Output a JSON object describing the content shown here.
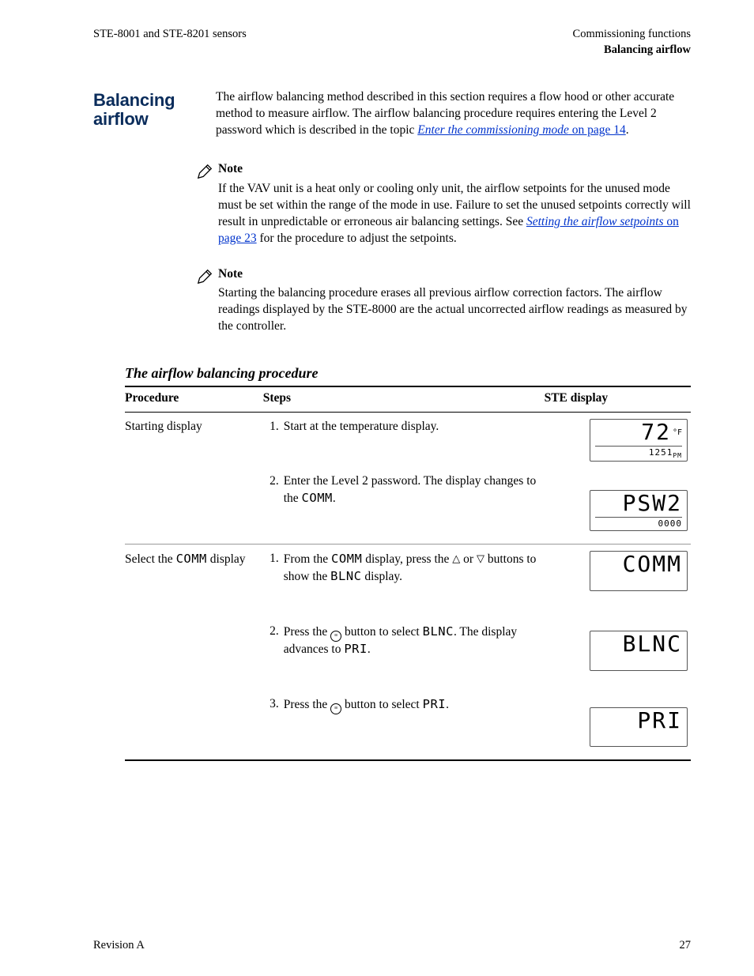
{
  "header": {
    "left": "STE-8001 and STE-8201 sensors",
    "right_top": "Commissioning functions",
    "right_sub": "Balancing airflow"
  },
  "section": {
    "heading": "Balancing airflow",
    "intro_a": "The airflow balancing method described in this section requires a flow hood or other accurate method to measure airflow. The airflow balancing procedure requires entering the Level 2 password which is described in the topic ",
    "intro_link_italic": "Enter the commissioning mode",
    "intro_link_plain": " on page 14",
    "intro_c": "."
  },
  "note1": {
    "label": "Note",
    "body_a": "If the VAV unit is a heat only or cooling only unit, the airflow setpoints for the unused mode must be set within the range of the mode in use. Failure to set the unused setpoints correctly will result in unpredictable or erroneous air balancing settings. See ",
    "link_italic": "Setting the airflow setpoints",
    "link_plain": " on page 23",
    "body_b": " for the procedure to adjust the setpoints."
  },
  "note2": {
    "label": "Note",
    "body": "Starting the balancing procedure erases all previous airflow correction factors. The airflow readings displayed by the STE-8000 are the actual uncorrected airflow readings as measured by the controller."
  },
  "table": {
    "caption": "The airflow balancing procedure",
    "col_procedure": "Procedure",
    "col_steps": "Steps",
    "col_display": "STE display",
    "rows": [
      {
        "procedure": "Starting display",
        "steps": [
          {
            "n": "1.",
            "t_a": "Start at the temperature display.",
            "t_b": "",
            "seg": ""
          },
          {
            "n": "2.",
            "t_a": "Enter the Level 2 password. The display changes to the ",
            "seg": "COMM",
            "t_b": "."
          }
        ],
        "displays": [
          {
            "main": "72",
            "sup": "°F",
            "sub": "1251",
            "subpm": "PM"
          },
          {
            "main": "PSW2",
            "sup": "",
            "sub": "0000",
            "subpm": ""
          }
        ]
      },
      {
        "procedure_a": "Select the ",
        "procedure_seg": "COMM",
        "procedure_b": " display",
        "steps": [
          {
            "n": "1.",
            "t_a": "From the ",
            "seg": "COMM",
            "t_b": " display, press the ",
            "tri_up": true,
            "t_c": " or ",
            "tri_down": true,
            "t_d": " buttons to show the ",
            "seg2": "BLNC",
            "t_e": " display."
          },
          {
            "n": "2.",
            "t_a": "Press the ",
            "circ": true,
            "t_b": " button to select ",
            "seg": "BLNC",
            "t_c": ". The display advances to ",
            "seg2": "PRI",
            "t_d": "."
          },
          {
            "n": "3.",
            "t_a": "Press the ",
            "circ": true,
            "t_b": " button to select ",
            "seg": "PRI",
            "t_c": "."
          }
        ],
        "displays": [
          {
            "main": "COMM",
            "sup": "",
            "sub": "",
            "subpm": ""
          },
          {
            "main": "BLNC",
            "sup": "",
            "sub": "",
            "subpm": ""
          },
          {
            "main": "PRI",
            "sup": "",
            "sub": "",
            "subpm": ""
          }
        ]
      }
    ]
  },
  "footer": {
    "left": "Revision A",
    "right": "27"
  }
}
